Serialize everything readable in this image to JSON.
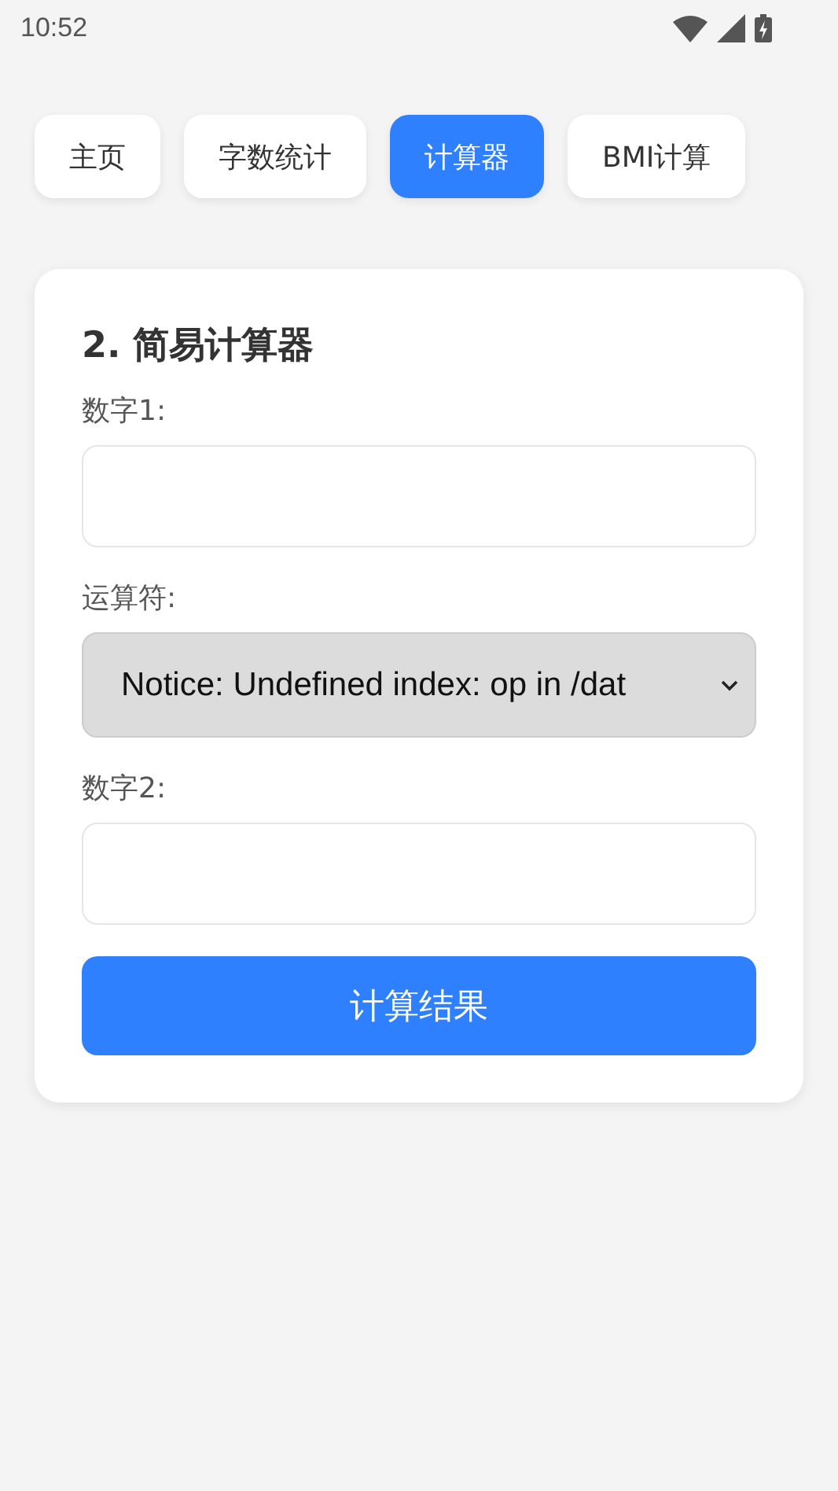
{
  "status_bar": {
    "time": "10:52"
  },
  "tabs": [
    {
      "label": "主页",
      "selected": false
    },
    {
      "label": "字数统计",
      "selected": false
    },
    {
      "label": "计算器",
      "selected": true
    },
    {
      "label": "BMI计算",
      "selected": false
    }
  ],
  "card": {
    "title": "2. 简易计算器",
    "fields": [
      {
        "kind": "input",
        "label": "数字1:"
      },
      {
        "kind": "select",
        "label": "运算符:",
        "value": "Notice: Undefined index: op in /dat"
      },
      {
        "kind": "input",
        "label": "数字2:"
      }
    ],
    "button": "计算结果"
  }
}
